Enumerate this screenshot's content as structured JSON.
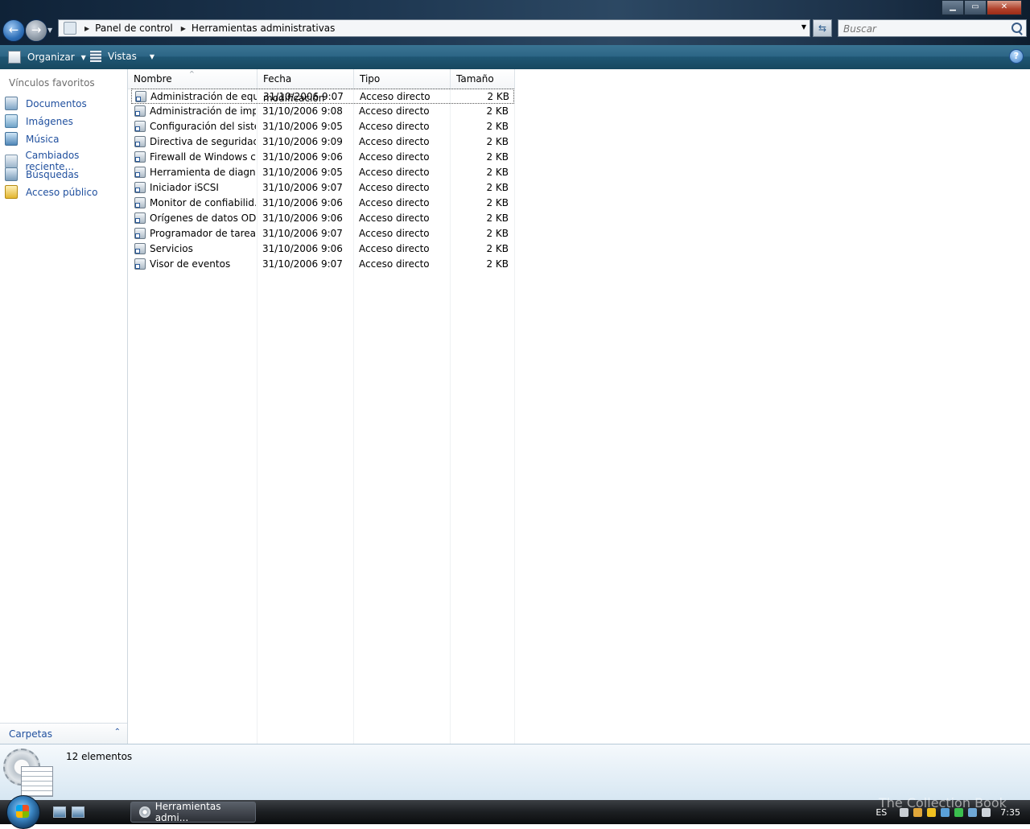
{
  "window": {
    "minimize": "▁",
    "maximize": "▭",
    "close": "✕"
  },
  "address": {
    "crumbs": [
      "Panel de control",
      "Herramientas administrativas"
    ]
  },
  "search": {
    "placeholder": "Buscar"
  },
  "toolbar": {
    "organize": "Organizar",
    "views": "Vistas",
    "help": "?"
  },
  "nav": {
    "heading": "Vínculos favoritos",
    "links": [
      "Documentos",
      "Imágenes",
      "Música",
      "Cambiados reciente...",
      "Búsquedas",
      "Acceso público"
    ],
    "folders": "Carpetas"
  },
  "columns": {
    "name": "Nombre",
    "date": "Fecha modificación",
    "type": "Tipo",
    "size": "Tamaño"
  },
  "files": [
    {
      "name": "Administración de equ...",
      "date": "31/10/2006 9:07",
      "type": "Acceso directo",
      "size": "2 KB"
    },
    {
      "name": "Administración de imp...",
      "date": "31/10/2006 9:08",
      "type": "Acceso directo",
      "size": "2 KB"
    },
    {
      "name": "Configuración del siste...",
      "date": "31/10/2006 9:05",
      "type": "Acceso directo",
      "size": "2 KB"
    },
    {
      "name": "Directiva de seguridad ...",
      "date": "31/10/2006 9:09",
      "type": "Acceso directo",
      "size": "2 KB"
    },
    {
      "name": "Firewall de Windows c...",
      "date": "31/10/2006 9:06",
      "type": "Acceso directo",
      "size": "2 KB"
    },
    {
      "name": "Herramienta de diagn...",
      "date": "31/10/2006 9:05",
      "type": "Acceso directo",
      "size": "2 KB"
    },
    {
      "name": "Iniciador iSCSI",
      "date": "31/10/2006 9:07",
      "type": "Acceso directo",
      "size": "2 KB"
    },
    {
      "name": "Monitor de confiabilid...",
      "date": "31/10/2006 9:06",
      "type": "Acceso directo",
      "size": "2 KB"
    },
    {
      "name": "Orígenes de datos ODBC",
      "date": "31/10/2006 9:06",
      "type": "Acceso directo",
      "size": "2 KB"
    },
    {
      "name": "Programador de tareas",
      "date": "31/10/2006 9:07",
      "type": "Acceso directo",
      "size": "2 KB"
    },
    {
      "name": "Servicios",
      "date": "31/10/2006 9:06",
      "type": "Acceso directo",
      "size": "2 KB"
    },
    {
      "name": "Visor de eventos",
      "date": "31/10/2006 9:07",
      "type": "Acceso directo",
      "size": "2 KB"
    }
  ],
  "details": {
    "count": "12 elementos"
  },
  "taskbar": {
    "window_button": "Herramientas admi...",
    "language": "ES",
    "clock": "7:35",
    "watermark": "The Collection Book"
  }
}
